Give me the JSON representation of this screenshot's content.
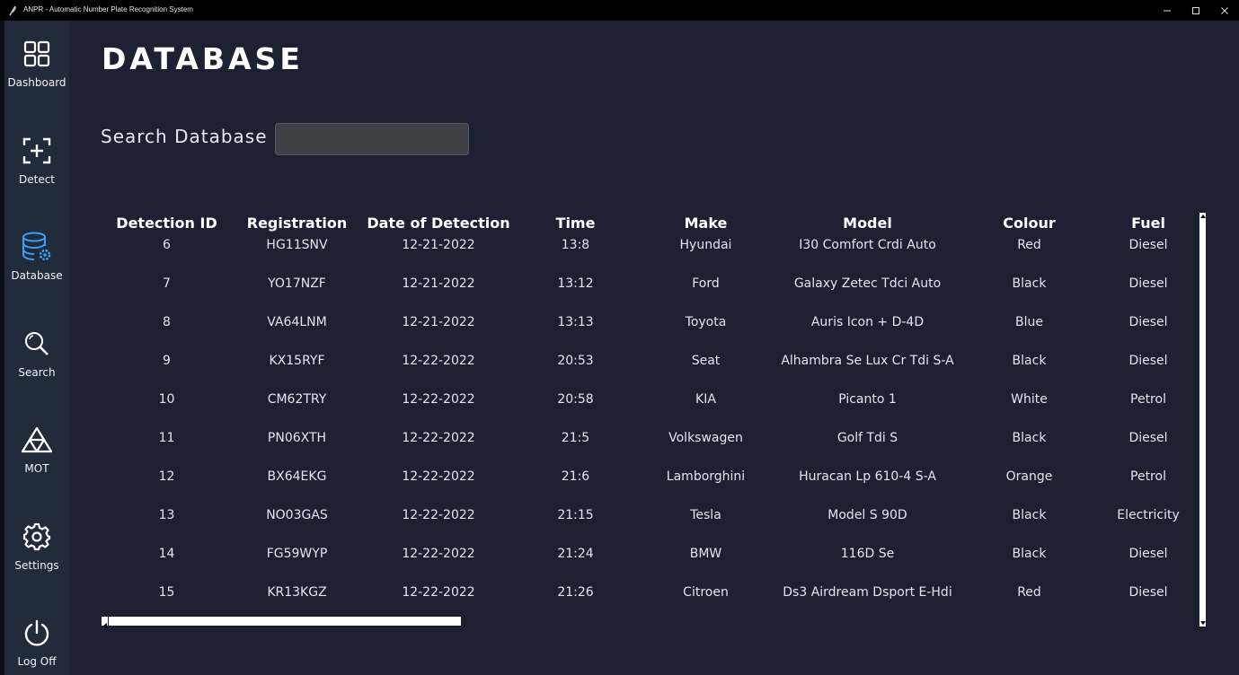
{
  "window": {
    "title": "ANPR - Automatic Number Plate Recognition System",
    "controls": {
      "minimize": "minimize-icon",
      "maximize": "maximize-icon",
      "close": "close-icon"
    }
  },
  "sidebar": {
    "items": [
      {
        "label": "Dashboard",
        "icon": "dashboard-grid-icon"
      },
      {
        "label": "Detect",
        "icon": "detect-frame-plus-icon"
      },
      {
        "label": "Database",
        "icon": "database-gear-icon",
        "active": true
      },
      {
        "label": "Search",
        "icon": "search-icon"
      },
      {
        "label": "MOT",
        "icon": "mot-triangles-icon"
      },
      {
        "label": "Settings",
        "icon": "gear-icon"
      },
      {
        "label": "Log Off",
        "icon": "power-icon"
      }
    ]
  },
  "page": {
    "title": "DATABASE",
    "search_label": "Search Database :",
    "search_value": ""
  },
  "table": {
    "columns": [
      "Detection ID",
      "Registration",
      "Date of Detection",
      "Time",
      "Make",
      "Model",
      "Colour",
      "Fuel"
    ],
    "rows": [
      [
        "6",
        "HG11SNV",
        "12-21-2022",
        "13:8",
        "Hyundai",
        "I30 Comfort Crdi Auto",
        "Red",
        "Diesel"
      ],
      [
        "7",
        "YO17NZF",
        "12-21-2022",
        "13:12",
        "Ford",
        "Galaxy Zetec Tdci Auto",
        "Black",
        "Diesel"
      ],
      [
        "8",
        "VA64LNM",
        "12-21-2022",
        "13:13",
        "Toyota",
        "Auris Icon + D-4D",
        "Blue",
        "Diesel"
      ],
      [
        "9",
        "KX15RYF",
        "12-22-2022",
        "20:53",
        "Seat",
        "Alhambra Se Lux Cr Tdi S-A",
        "Black",
        "Diesel"
      ],
      [
        "10",
        "CM62TRY",
        "12-22-2022",
        "20:58",
        "KIA",
        "Picanto 1",
        "White",
        "Petrol"
      ],
      [
        "11",
        "PN06XTH",
        "12-22-2022",
        "21:5",
        "Volkswagen",
        "Golf Tdi S",
        "Black",
        "Diesel"
      ],
      [
        "12",
        "BX64EKG",
        "12-22-2022",
        "21:6",
        "Lamborghini",
        "Huracan Lp 610-4 S-A",
        "Orange",
        "Petrol"
      ],
      [
        "13",
        "NO03GAS",
        "12-22-2022",
        "21:15",
        "Tesla",
        "Model S 90D",
        "Black",
        "Electricity"
      ],
      [
        "14",
        "FG59WYP",
        "12-22-2022",
        "21:24",
        "BMW",
        "116D Se",
        "Black",
        "Diesel"
      ],
      [
        "15",
        "KR13KGZ",
        "12-22-2022",
        "21:26",
        "Citroen",
        "Ds3 Airdream Dsport E-Hdi",
        "Red",
        "Diesel"
      ]
    ]
  },
  "colors": {
    "sidebar_bg": "#222b3a",
    "main_bg": "#1b2130",
    "accent_database_icon": "#3aa0ff"
  }
}
